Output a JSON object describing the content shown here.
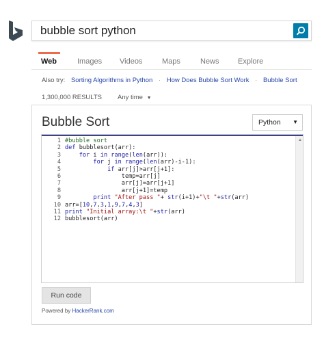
{
  "search": {
    "query": "bubble sort python",
    "icon": "search-icon"
  },
  "tabs": [
    {
      "label": "Web",
      "active": true
    },
    {
      "label": "Images",
      "active": false
    },
    {
      "label": "Videos",
      "active": false
    },
    {
      "label": "Maps",
      "active": false
    },
    {
      "label": "News",
      "active": false
    },
    {
      "label": "Explore",
      "active": false
    }
  ],
  "also_try": {
    "label": "Also try:",
    "links": [
      "Sorting Algorithms in Python",
      "How Does Bubble Sort Work",
      "Bubble Sort"
    ],
    "separator": "·"
  },
  "results": {
    "count": "1,300,000 RESULTS",
    "time_filter": "Any time"
  },
  "card": {
    "title": "Bubble Sort",
    "language": "Python",
    "run_label": "Run code",
    "powered_prefix": "Powered by ",
    "powered_link": "HackerRank.com"
  },
  "code_lines": [
    [
      [
        "c",
        "#bubble sort"
      ]
    ],
    [
      [
        "k",
        "def "
      ],
      [
        "p",
        "bubblesort(arr):"
      ]
    ],
    [
      [
        "p",
        "    "
      ],
      [
        "k",
        "for "
      ],
      [
        "p",
        "i "
      ],
      [
        "k",
        "in "
      ],
      [
        "k",
        "range"
      ],
      [
        "p",
        "("
      ],
      [
        "k",
        "len"
      ],
      [
        "p",
        "(arr)):"
      ]
    ],
    [
      [
        "p",
        "        "
      ],
      [
        "k",
        "for "
      ],
      [
        "p",
        "j "
      ],
      [
        "k",
        "in "
      ],
      [
        "k",
        "range"
      ],
      [
        "p",
        "("
      ],
      [
        "k",
        "len"
      ],
      [
        "p",
        "(arr)-i-1):"
      ]
    ],
    [
      [
        "p",
        "            "
      ],
      [
        "k",
        "if "
      ],
      [
        "p",
        "arr[j]>arr[j+1]:"
      ]
    ],
    [
      [
        "p",
        "                temp=arr[j]"
      ]
    ],
    [
      [
        "p",
        "                arr[j]=arr[j+1]"
      ]
    ],
    [
      [
        "p",
        "                arr[j+1]=temp"
      ]
    ],
    [
      [
        "p",
        "        "
      ],
      [
        "k",
        "print "
      ],
      [
        "s",
        "\"After pass \""
      ],
      [
        "p",
        "+ "
      ],
      [
        "k",
        "str"
      ],
      [
        "p",
        "(i+1)+"
      ],
      [
        "s",
        "\"\\t \""
      ],
      [
        "p",
        "+"
      ],
      [
        "k",
        "str"
      ],
      [
        "p",
        "(arr)"
      ]
    ],
    [
      [
        "p",
        "arr=["
      ],
      [
        "n",
        "10"
      ],
      [
        "p",
        ","
      ],
      [
        "n",
        "7"
      ],
      [
        "p",
        ","
      ],
      [
        "n",
        "3"
      ],
      [
        "p",
        ","
      ],
      [
        "n",
        "1"
      ],
      [
        "p",
        ","
      ],
      [
        "n",
        "9"
      ],
      [
        "p",
        ","
      ],
      [
        "n",
        "7"
      ],
      [
        "p",
        ","
      ],
      [
        "n",
        "4"
      ],
      [
        "p",
        ","
      ],
      [
        "n",
        "3"
      ],
      [
        "p",
        "]"
      ]
    ],
    [
      [
        "k",
        "print "
      ],
      [
        "s",
        "\"Initial array:\\t \""
      ],
      [
        "p",
        "+"
      ],
      [
        "k",
        "str"
      ],
      [
        "p",
        "(arr)"
      ]
    ],
    [
      [
        "p",
        "bubblesort(arr)"
      ]
    ]
  ],
  "colors": {
    "accent": "#ec6b4c",
    "link": "#2546a9",
    "search_button": "#007daa",
    "logo": "#3c4b53"
  },
  "icons": {
    "logo": "bing-logo",
    "dropdown": "caret-down-icon"
  }
}
